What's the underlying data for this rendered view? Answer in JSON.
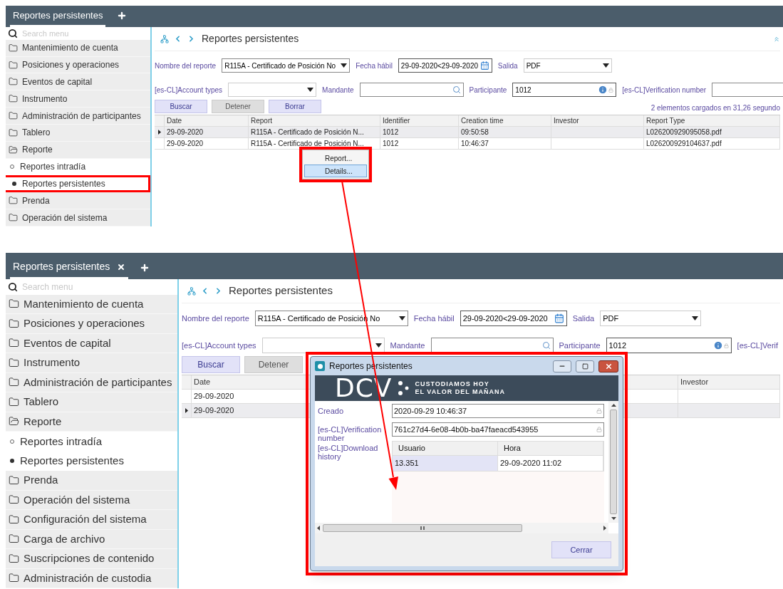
{
  "screens": [
    {
      "kind": "small",
      "tab": {
        "label": "Reportes persistentes",
        "closable": false
      },
      "search": {
        "placeholder": "Search menu"
      },
      "menu": [
        {
          "label": "Mantenimiento de cuenta",
          "expanded": false
        },
        {
          "label": "Posiciones y operaciones",
          "expanded": false
        },
        {
          "label": "Eventos de capital",
          "expanded": false
        },
        {
          "label": "Instrumento",
          "expanded": false
        },
        {
          "label": "Administración de participantes",
          "expanded": false
        },
        {
          "label": "Tablero",
          "expanded": false
        },
        {
          "label": "Reporte",
          "expanded": true,
          "children": [
            {
              "label": "Reportes intradía",
              "selected": false,
              "highlighted": false
            },
            {
              "label": "Reportes persistentes",
              "selected": true,
              "highlighted": true
            }
          ]
        },
        {
          "label": "Prenda",
          "expanded": false
        },
        {
          "label": "Operación del sistema",
          "expanded": false
        }
      ],
      "title": "Reportes persistentes",
      "collapse_icon": true,
      "filters": [
        [
          {
            "label": "Nombre del reporte",
            "kind": "select",
            "value": "R115A - Certificado de Posición No"
          },
          {
            "label": "Fecha hábil",
            "kind": "date",
            "value": "29-09-2020<29-09-2020"
          },
          {
            "label": "Salida",
            "kind": "dropdown",
            "value": "PDF"
          }
        ],
        [
          {
            "label": "[es-CL]Account types",
            "kind": "dropdown"
          },
          {
            "label": "Mandante",
            "kind": "search"
          },
          {
            "label": "Participante",
            "kind": "info",
            "value": "1012"
          },
          {
            "label": "[es-CL]Verification number",
            "kind": "text"
          }
        ]
      ],
      "buttons": [
        {
          "label": "Buscar",
          "disabled": false
        },
        {
          "label": "Detener",
          "disabled": true
        },
        {
          "label": "Borrar",
          "disabled": false
        }
      ],
      "status": "2 elementos cargados en 31,26 segundo",
      "columns": [
        "Date",
        "Report",
        "Identifier",
        "Creation time",
        "Investor",
        "Report Type"
      ],
      "rows": [
        {
          "current": true,
          "cells": [
            "29-09-2020",
            "R115A - Certificado de Posición N...",
            "1012",
            "09:50:58",
            "",
            "L026200929095058.pdf"
          ]
        },
        {
          "current": false,
          "cells": [
            "29-09-2020",
            "R115A - Certificado de Posición N...",
            "1012",
            "10:46:37",
            "",
            "L026200929104637.pdf"
          ]
        }
      ]
    },
    {
      "kind": "large",
      "tab": {
        "label": "Reportes persistentes",
        "closable": true
      },
      "search": {
        "placeholder": "Search menu"
      },
      "menu": [
        {
          "label": "Mantenimiento de cuenta",
          "expanded": false
        },
        {
          "label": "Posiciones y operaciones",
          "expanded": false
        },
        {
          "label": "Eventos de capital",
          "expanded": false
        },
        {
          "label": "Instrumento",
          "expanded": false
        },
        {
          "label": "Administración de participantes",
          "expanded": false
        },
        {
          "label": "Tablero",
          "expanded": false
        },
        {
          "label": "Reporte",
          "expanded": true,
          "children": [
            {
              "label": "Reportes intradía",
              "selected": false,
              "highlighted": false
            },
            {
              "label": "Reportes persistentes",
              "selected": true,
              "highlighted": false
            }
          ]
        },
        {
          "label": "Prenda",
          "expanded": false
        },
        {
          "label": "Operación del sistema",
          "expanded": false
        },
        {
          "label": "Configuración del sistema",
          "expanded": false
        },
        {
          "label": "Carga de archivo",
          "expanded": false
        },
        {
          "label": "Suscripciones de contenido",
          "expanded": false
        },
        {
          "label": "Administración de custodia",
          "expanded": false
        }
      ],
      "title": "Reportes persistentes",
      "collapse_icon": false,
      "filters": [
        [
          {
            "label": "Nombre del reporte",
            "kind": "select",
            "value": "R115A - Certificado de Posición No"
          },
          {
            "label": "Fecha hábil",
            "kind": "date",
            "value": "29-09-2020<29-09-2020"
          },
          {
            "label": "Salida",
            "kind": "dropdown",
            "value": "PDF"
          }
        ],
        [
          {
            "label": "[es-CL]Account types",
            "kind": "dropdown"
          },
          {
            "label": "Mandante",
            "kind": "search"
          },
          {
            "label": "Participante",
            "kind": "info",
            "value": "1012"
          },
          {
            "label": "[es-CL]Verif",
            "kind": "text"
          }
        ]
      ],
      "buttons": [
        {
          "label": "Buscar",
          "disabled": false
        },
        {
          "label": "Detener",
          "disabled": true
        }
      ],
      "columns": [
        "Date",
        "Investor"
      ],
      "rows": [
        {
          "current": false,
          "cells": [
            "29-09-2020",
            ""
          ]
        },
        {
          "current": true,
          "cells": [
            "29-09-2020",
            ""
          ]
        }
      ]
    }
  ],
  "context_menu": {
    "highlighted": true,
    "items": [
      {
        "label": "Report...",
        "selected": false
      },
      {
        "label": "Details...",
        "selected": true
      }
    ]
  },
  "dialog": {
    "highlighted": true,
    "title": "Reportes persistentes",
    "banner": {
      "logo": "DCV",
      "tagline": [
        "CUSTODIAMOS HOY",
        "EL VALOR DEL MAÑANA"
      ]
    },
    "fields": [
      {
        "label": "Creado",
        "value": "2020-09-29 10:46:37"
      },
      {
        "label": "[es-CL]Verification number",
        "value": "761c27d4-6e08-4b0b-ba47faeacd543955"
      }
    ],
    "history": {
      "label": "[es-CL]Download history",
      "columns": [
        "Usuario",
        "Hora"
      ],
      "rows": [
        [
          "13.351",
          "29-09-2020 11:02"
        ]
      ]
    },
    "close_button": "Cerrar"
  }
}
